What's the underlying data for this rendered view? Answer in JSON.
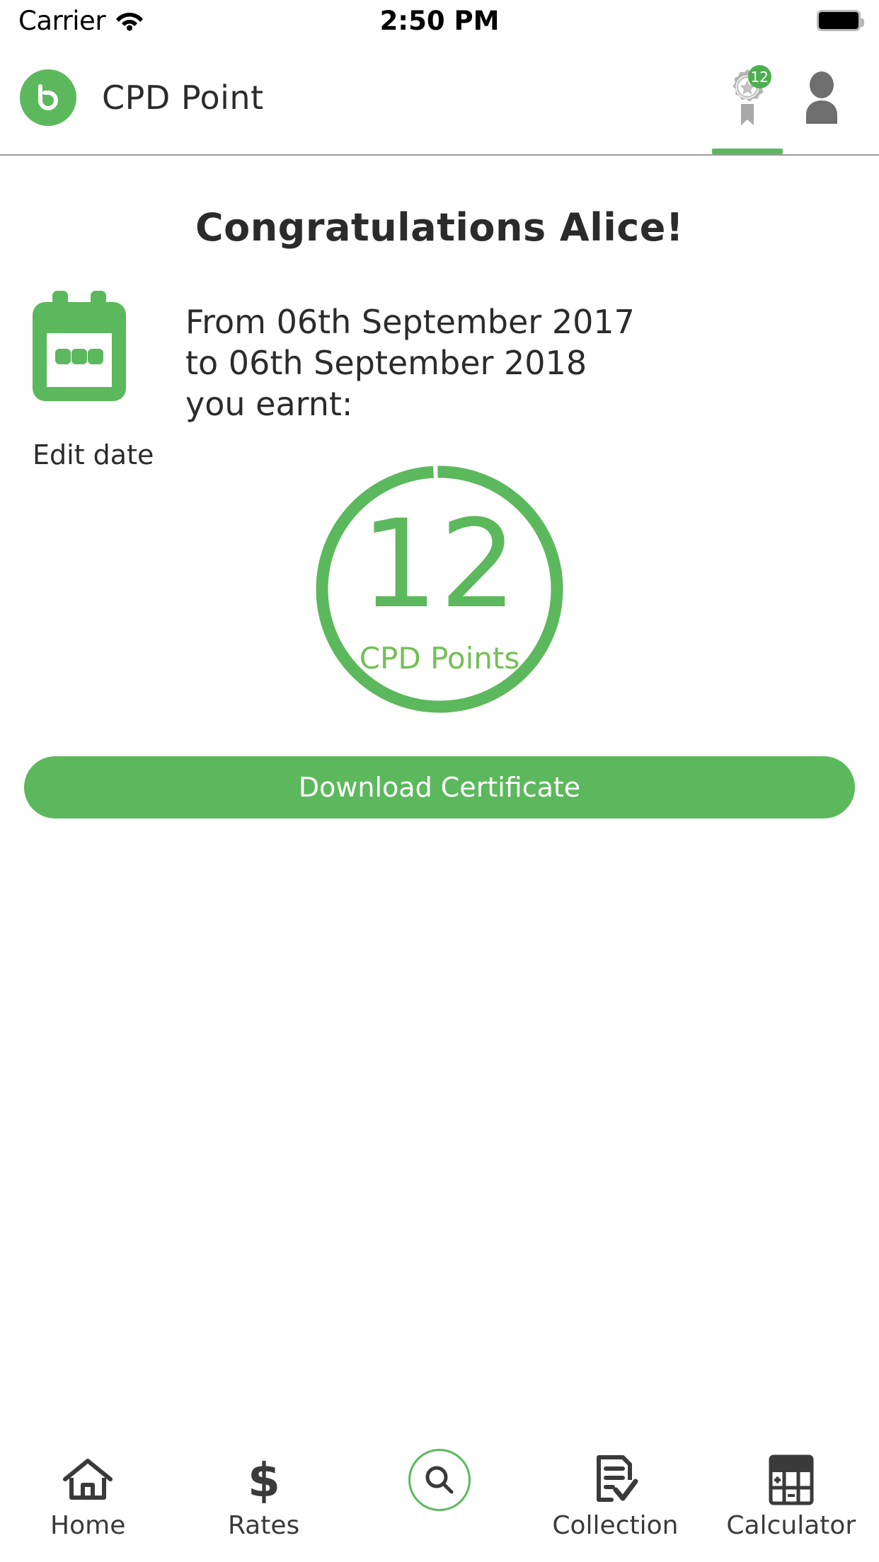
{
  "status_bar": {
    "carrier": "Carrier",
    "wifi_icon": "wifi-icon",
    "time": "2:50 PM",
    "battery_icon": "battery-full-icon"
  },
  "header": {
    "logo_icon": "brand-b-logo",
    "title": "CPD Point",
    "actions": [
      {
        "name": "badge-award-icon",
        "badge_count": "12",
        "active": true
      },
      {
        "name": "profile-avatar-icon",
        "badge_count": "",
        "active": false
      }
    ]
  },
  "main": {
    "congratulations": "Congratulations Alice!",
    "calendar_icon": "calendar-icon",
    "edit_date_label": "Edit date",
    "date_range_text": "From 06th September 2017 to 06th September 2018 you earnt:",
    "date_lines": [
      "From 06th September 2017",
      "to 06th September 2018",
      "you earnt:"
    ],
    "points_value": "12",
    "points_label": "CPD Points",
    "download_button": "Download Certificate"
  },
  "tabbar": {
    "items": [
      {
        "label": "Home",
        "icon": "home-icon",
        "active": false
      },
      {
        "label": "Rates",
        "icon": "dollar-icon",
        "active": false
      },
      {
        "label": "",
        "icon": "search-icon",
        "active": true
      },
      {
        "label": "Collection",
        "icon": "document-check-icon",
        "active": false
      },
      {
        "label": "Calculator",
        "icon": "calculator-icon",
        "active": false
      }
    ]
  },
  "colors": {
    "brand_green": "#5cb85c",
    "label_green": "#74bf56",
    "text_dark": "#2b2b2b",
    "icon_gray": "#6e6e6e",
    "badge_green": "#4caf50"
  },
  "progress": {
    "value": 12,
    "ring_fraction": 0.99
  }
}
